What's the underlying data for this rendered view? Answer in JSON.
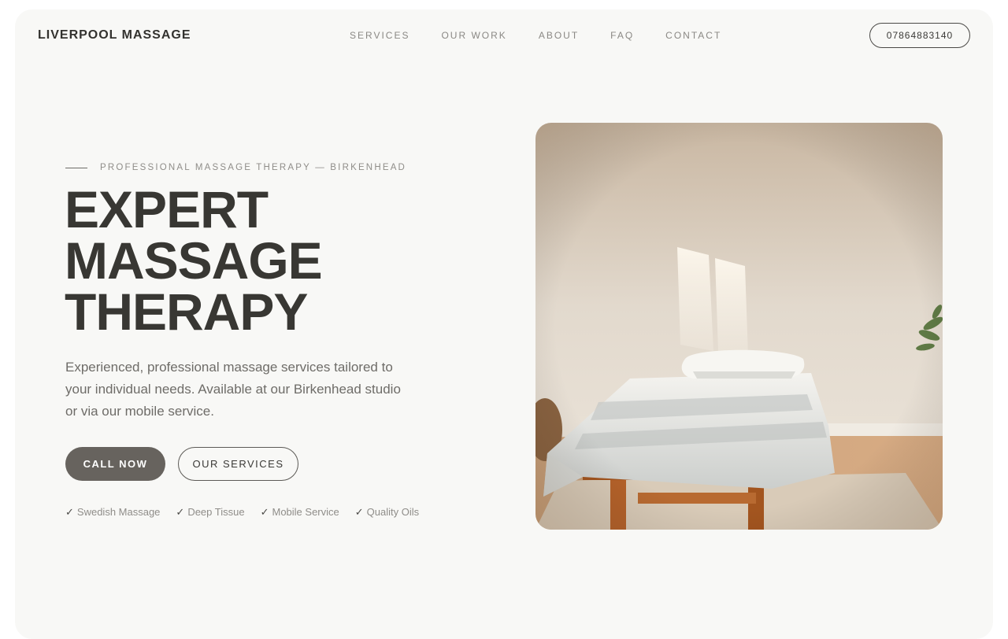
{
  "brand": "LIVERPOOL MASSAGE",
  "nav": {
    "items": [
      "SERVICES",
      "OUR WORK",
      "ABOUT",
      "FAQ",
      "CONTACT"
    ]
  },
  "phone_button": "07864883140",
  "hero": {
    "eyebrow": "PROFESSIONAL MASSAGE THERAPY — BIRKENHEAD",
    "headline_lines": [
      "EXPERT",
      "MASSAGE",
      "THERAPY"
    ],
    "lead": "Experienced, professional massage services tailored to your individual needs. Available at our Birkenhead studio or via our mobile service.",
    "primary_button": "CALL NOW",
    "secondary_button": "OUR SERVICES",
    "features": [
      "Swedish Massage",
      "Deep Tissue",
      "Mobile Service",
      "Quality Oils"
    ],
    "check_glyph": "✓",
    "image_subject": "massage table in sunlit room"
  },
  "colors": {
    "background": "#f8f8f6",
    "text_dark": "#383733",
    "text_muted": "#8f8d89",
    "button_primary": "#67635e"
  }
}
